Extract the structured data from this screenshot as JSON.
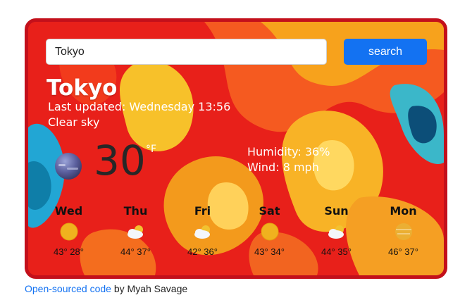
{
  "search": {
    "value": "Tokyo",
    "button_label": "search"
  },
  "current": {
    "city": "Tokyo",
    "last_updated": "Last updated: Wednesday 13:56",
    "description": "Clear sky",
    "temperature": "30",
    "unit": "°F",
    "humidity": "Humidity: 36%",
    "wind": "Wind: 8 mph",
    "icon": "night-moon-icon"
  },
  "forecast": [
    {
      "day": "Wed",
      "temps": "43° 28°",
      "icon": "sun-icon"
    },
    {
      "day": "Thu",
      "temps": "44° 37°",
      "icon": "cloud-sun-icon"
    },
    {
      "day": "Fri",
      "temps": "42° 36°",
      "icon": "cloud-sun-icon"
    },
    {
      "day": "Sat",
      "temps": "43° 34°",
      "icon": "sun-icon"
    },
    {
      "day": "Sun",
      "temps": "44° 35°",
      "icon": "cloud-sun-icon"
    },
    {
      "day": "Mon",
      "temps": "46° 37°",
      "icon": "hazy-sun-icon"
    }
  ],
  "footer": {
    "link_text": "Open-sourced code",
    "suffix": " by Myah Savage"
  },
  "colors": {
    "accent": "#1372f2",
    "card_border": "#c3101b"
  }
}
